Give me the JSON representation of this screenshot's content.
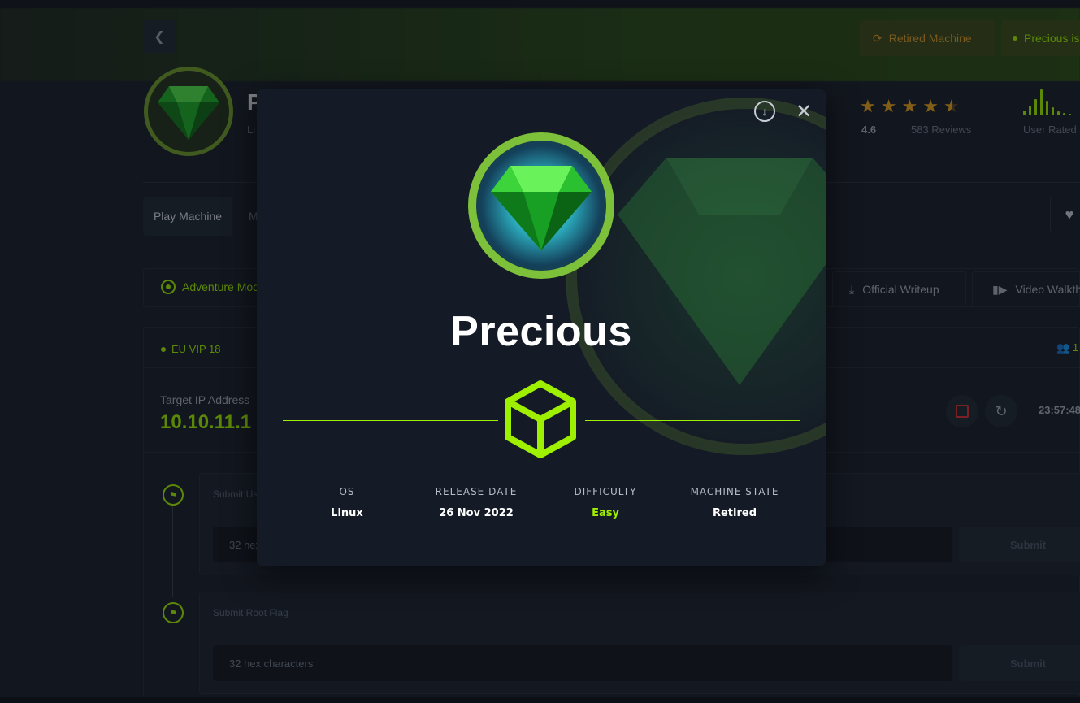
{
  "header": {
    "retired_label": "Retired Machine",
    "live_label": "Precious is",
    "title_initial": "P",
    "subtitle": "Li",
    "rating_value": "4.6",
    "reviews": "583 Reviews",
    "user_rated": "User Rated",
    "rating_fraction": 0.9
  },
  "tabs": {
    "play": "Play Machine",
    "other_partial": "M"
  },
  "mode": {
    "adventure": "Adventure Mod",
    "writeup": "Official Writeup",
    "video": "Video Walkth"
  },
  "vpn": {
    "server": "EU VIP 18",
    "players": "1",
    "target_label": "Target IP Address",
    "target_ip": "10.10.11.1",
    "timer": "23:57:48"
  },
  "flags": [
    {
      "label": "Submit Us",
      "placeholder": "32 hex",
      "submit": "Submit"
    },
    {
      "label": "Submit Root Flag",
      "placeholder": "32 hex characters",
      "submit": "Submit"
    }
  ],
  "modal": {
    "title": "Precious",
    "meta": [
      {
        "label": "OS",
        "value": "Linux"
      },
      {
        "label": "RELEASE DATE",
        "value": "26 Nov 2022"
      },
      {
        "label": "DIFFICULTY",
        "value": "Easy"
      },
      {
        "label": "MACHINE STATE",
        "value": "Retired"
      }
    ]
  },
  "colors": {
    "accent": "#9fef00",
    "retired": "#d89a2a",
    "star": "#e7a21d",
    "stop": "#d9333a"
  }
}
